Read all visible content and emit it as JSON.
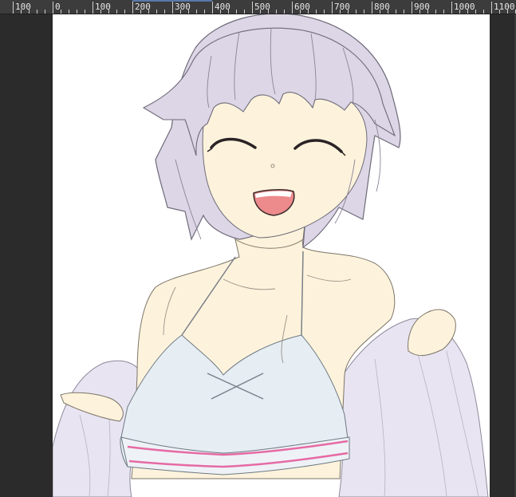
{
  "ruler": {
    "labels": [
      "100",
      "0",
      "100",
      "200",
      "300",
      "400",
      "500",
      "600",
      "700",
      "800",
      "900",
      "1000",
      "1100"
    ]
  },
  "colors": {
    "workspace": "#2b2b2b",
    "ruler_bg": "#3c3c3c",
    "ruler_text": "#e6e6e6",
    "canvas": "#ffffff",
    "hair": "#dcd6e6",
    "skin": "#fdf3dc",
    "top": "#e6edf3",
    "jacket": "#e8e4f1",
    "mouth": "#ec8a8c",
    "stripe": "#e66aa4"
  },
  "artwork": {
    "subject_icon": "anime-girl-illustration"
  }
}
